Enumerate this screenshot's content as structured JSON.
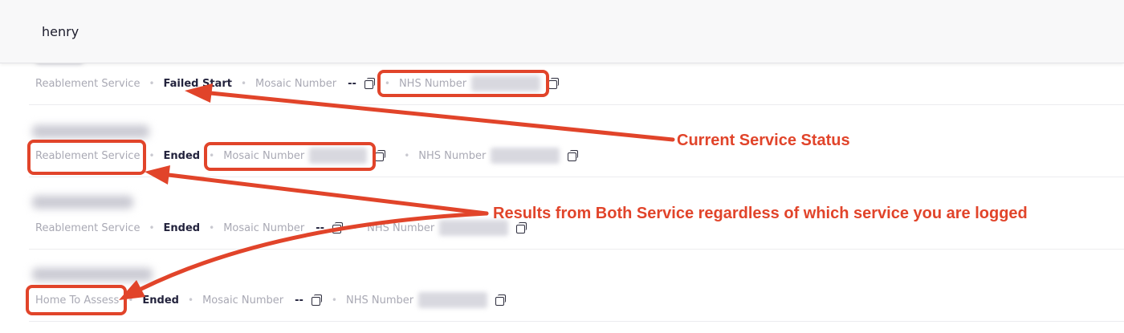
{
  "search": {
    "query": "henry"
  },
  "rows": [
    {
      "service": "Reablement Service",
      "status": "Failed Start",
      "mosaic_label": "Mosaic Number",
      "mosaic_value": "--",
      "nhs_label": "NHS Number"
    },
    {
      "service": "Reablement Service",
      "status": "Ended",
      "mosaic_label": "Mosaic Number",
      "nhs_label": "NHS Number"
    },
    {
      "service": "Reablement Service",
      "status": "Ended",
      "mosaic_label": "Mosaic Number",
      "mosaic_value": "--",
      "nhs_label": "NHS Number"
    },
    {
      "service": "Home To Assess",
      "status": "Ended",
      "mosaic_label": "Mosaic Number",
      "mosaic_value": "--",
      "nhs_label": "NHS Number"
    }
  ],
  "annotations": {
    "status_callout": "Current Service Status",
    "services_callout": "Results from Both Service regardless of which service you are logged",
    "color": "#e1442a"
  },
  "icons": [
    "copy-icon"
  ]
}
